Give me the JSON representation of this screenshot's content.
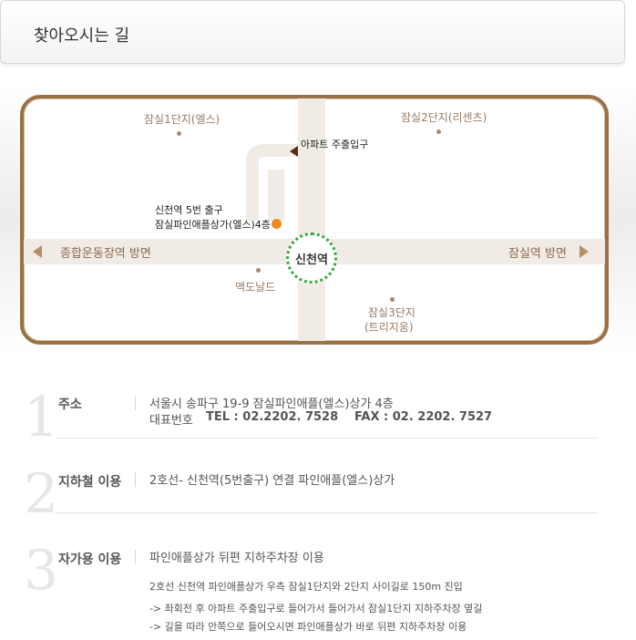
{
  "header": {
    "title": "찾아오시는 길"
  },
  "map": {
    "places": {
      "jamsil1": "잠실1단지(엘스)",
      "jamsil2": "잠실2단지(리센츠)",
      "apt_entrance": "아파트 주출입구",
      "exit_line1": "신천역 5번 출구",
      "exit_line2": "잠실파인애플상가(엘스)4층",
      "station": "신천역",
      "mcdonalds": "맥도날드",
      "jamsil3_line1": "잠실3단지",
      "jamsil3_line2": "(트리지움)"
    },
    "directions": {
      "left": "종합운동장역 방면",
      "right": "잠실역 방면"
    },
    "colors": {
      "frame": "#9b7048",
      "station_ring": "#3aa93a",
      "marker": "#f08a1c"
    }
  },
  "sections": [
    {
      "number": "1",
      "title": "주소",
      "lines": [
        "서울시 송파구 19-9 잠실파인애플(엘스)상가 4층"
      ],
      "rep_label": "대표번호",
      "tel": "TEL : 02.2202. 7528",
      "fax": "FAX : 02. 2202. 7527"
    },
    {
      "number": "2",
      "title": "지하철 이용",
      "lines": [
        "2호선- 신천역(5번출구) 연결 파인애플(엘스)상가"
      ]
    },
    {
      "number": "3",
      "title": "자가용 이용",
      "lines": [
        "파인애플상가 뒤편 지하주차장 이용",
        "2호선 신천역 파인애플상가 우측 잠실1단지와 2단지 사이길로 150m 진입",
        "-> 좌회전 후 아파트 주출입구로 들어가서 들어가서 잠실1단지 지하주차장 옆길",
        "-> 길을 따라 안쪽으로 들어오시면 파인애플상가 바로 뒤편 지하주차장 이용"
      ]
    }
  ]
}
